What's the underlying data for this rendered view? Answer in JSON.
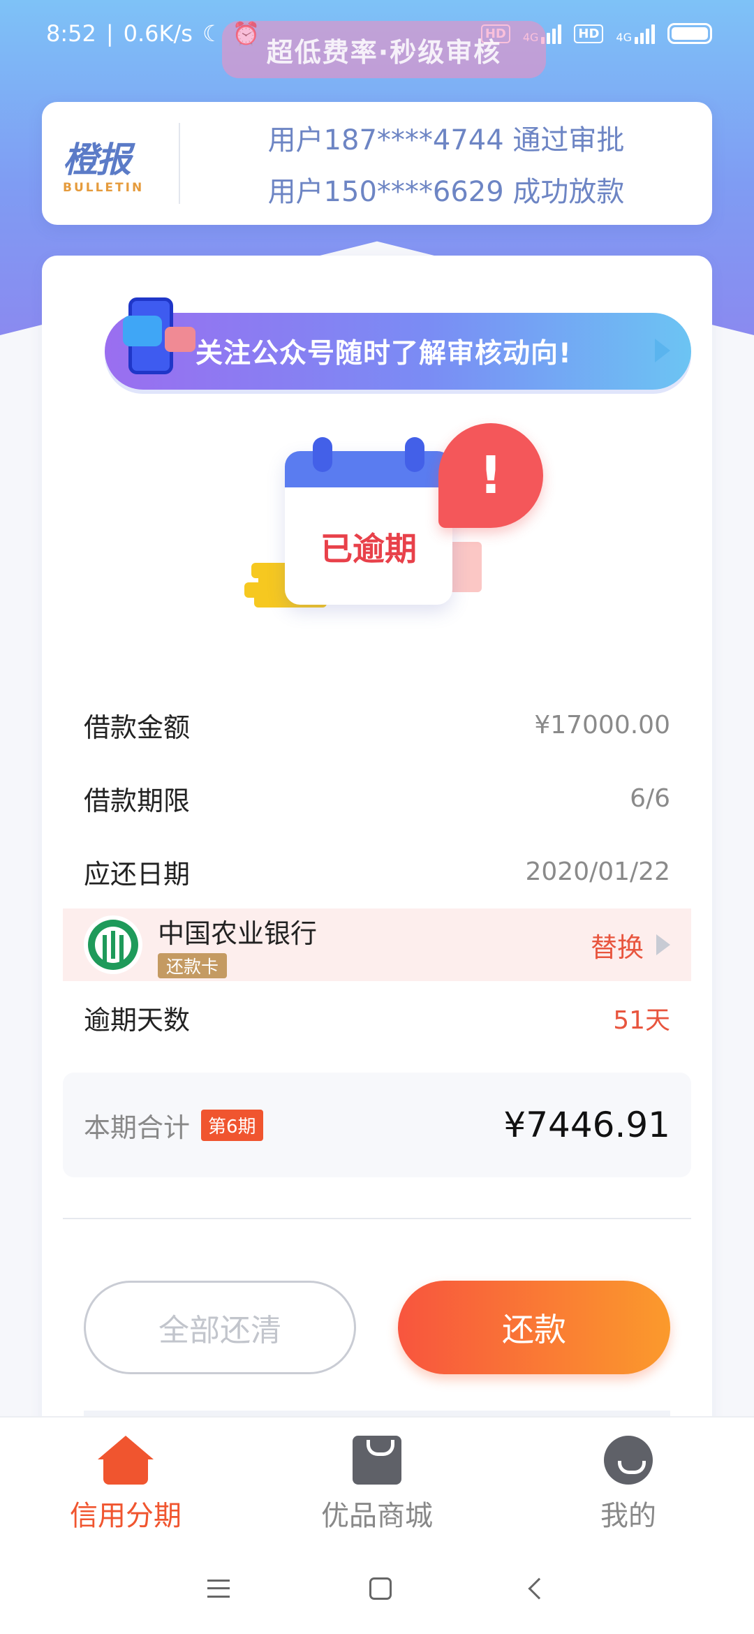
{
  "status_bar": {
    "time": "8:52",
    "net_speed": "0.6K/s",
    "hd_1": "HD",
    "net_1": "4G",
    "hd_2": "HD",
    "net_2": "4G"
  },
  "promo": {
    "text": "超低费率·秒级审核"
  },
  "bulletin": {
    "logo_main": "橙报",
    "logo_sub": "BULLETIN",
    "lines": [
      "用户187****4744 通过审批",
      "用户150****6629 成功放款"
    ]
  },
  "follow_banner": {
    "text": "关注公众号随时了解审核动向!"
  },
  "illustration": {
    "status_text": "已逾期",
    "alert_mark": "!"
  },
  "loan": {
    "amount_label": "借款金额",
    "amount_value": "¥17000.00",
    "term_label": "借款期限",
    "term_value": "6/6",
    "due_label": "应还日期",
    "due_value": "2020/01/22",
    "overdue_label": "逾期天数",
    "overdue_value": "51天"
  },
  "bank": {
    "name": "中国农业银行",
    "tag": "还款卡",
    "action": "替换"
  },
  "total": {
    "label": "本期合计",
    "period_badge": "第6期",
    "amount": "¥7446.91"
  },
  "actions": {
    "clear_all": "全部还清",
    "repay": "还款"
  },
  "tabs": [
    {
      "label": "信用分期",
      "icon": "home-icon",
      "active": true
    },
    {
      "label": "优品商城",
      "icon": "shopping-bag-icon",
      "active": false
    },
    {
      "label": "我的",
      "icon": "profile-icon",
      "active": false
    }
  ],
  "colors": {
    "accent": "#f0552f",
    "hero_blue": "#7f9cf3",
    "bank_green": "#1e9a5a"
  }
}
